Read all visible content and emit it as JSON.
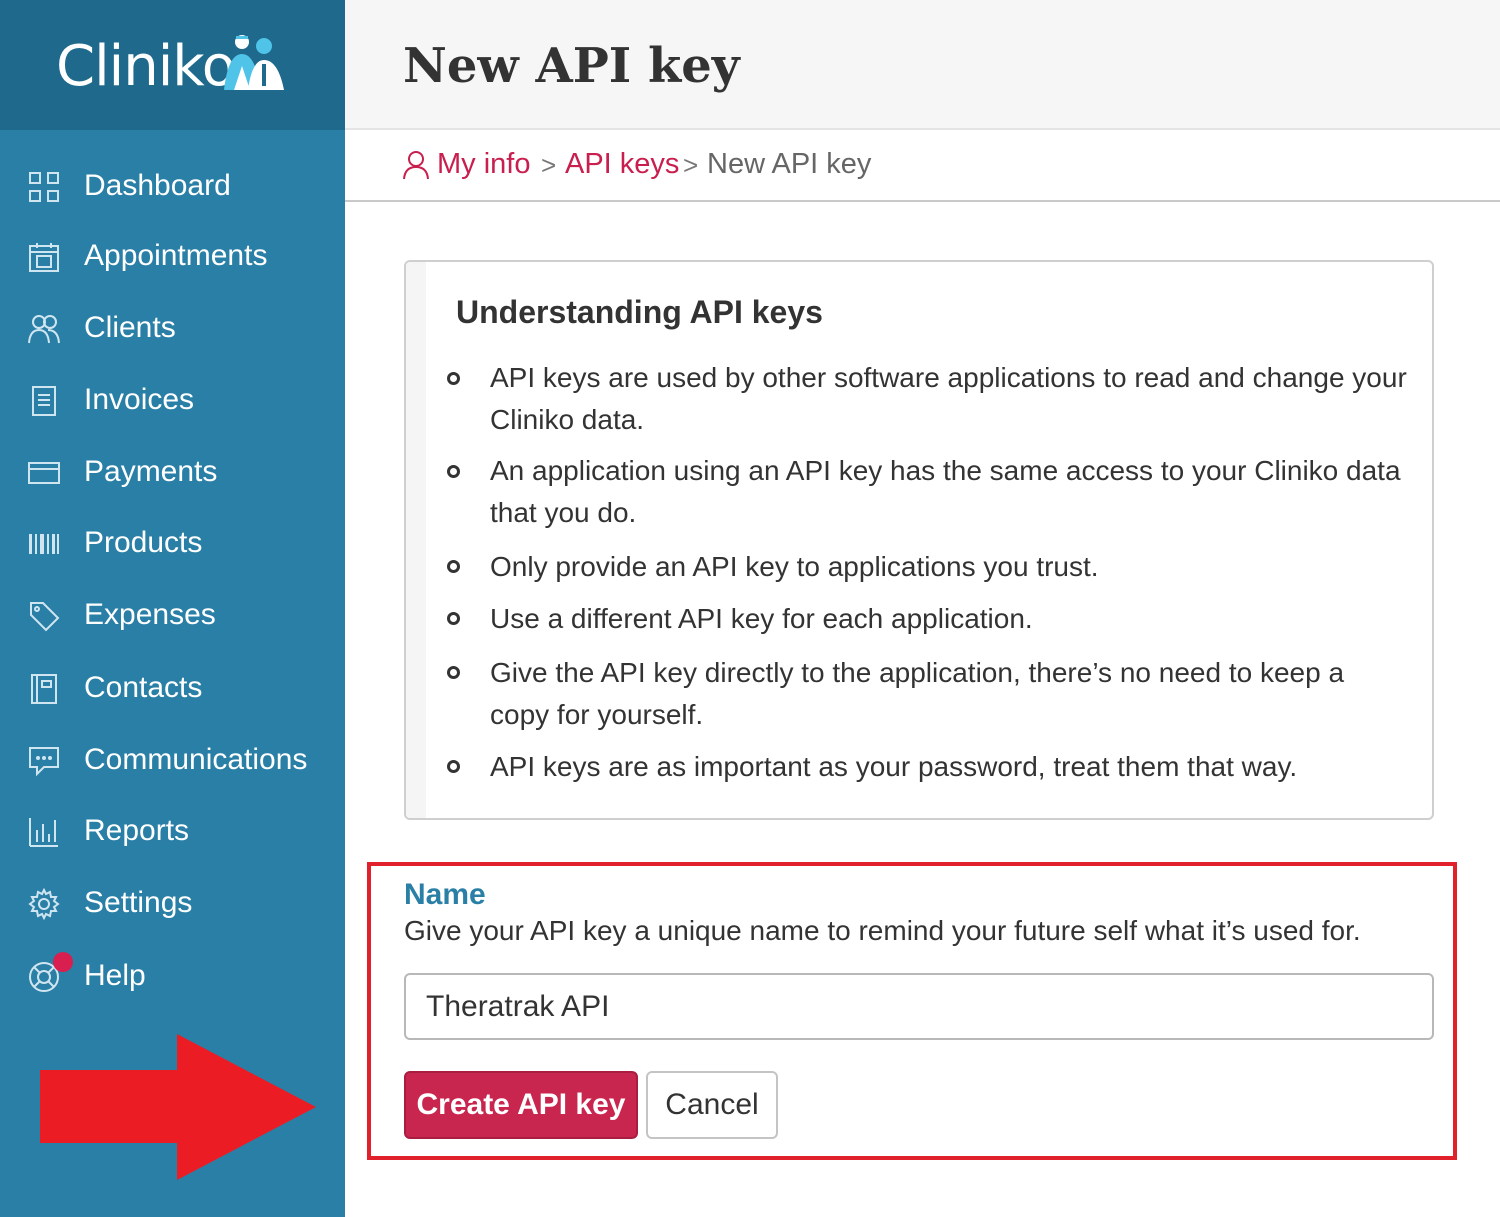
{
  "app": {
    "brand_name": "Cliniko",
    "brand_color": "#2a7fa6",
    "accent_color": "#c8264f",
    "logo_icon": "cliniko-people-icon"
  },
  "sidebar": {
    "items": [
      {
        "label": "Dashboard",
        "icon": "dashboard-grid-icon"
      },
      {
        "label": "Appointments",
        "icon": "calendar-icon"
      },
      {
        "label": "Clients",
        "icon": "people-icon"
      },
      {
        "label": "Invoices",
        "icon": "document-icon"
      },
      {
        "label": "Payments",
        "icon": "credit-card-icon"
      },
      {
        "label": "Products",
        "icon": "barcode-icon"
      },
      {
        "label": "Expenses",
        "icon": "tag-icon"
      },
      {
        "label": "Contacts",
        "icon": "address-book-icon"
      },
      {
        "label": "Communications",
        "icon": "chat-icon"
      },
      {
        "label": "Reports",
        "icon": "bar-chart-icon"
      },
      {
        "label": "Settings",
        "icon": "gear-icon"
      },
      {
        "label": "Help",
        "icon": "lifebuoy-icon"
      }
    ]
  },
  "header": {
    "title": "New API key"
  },
  "breadcrumb": {
    "items": [
      "My info",
      "API keys",
      "New API key"
    ],
    "separator": ">"
  },
  "info_box": {
    "title": "Understanding API keys",
    "bullets": [
      "API keys are used by other software applications to read and change your Cliniko data.",
      "An application using an API key has the same access to your Cliniko data that you do.",
      "Only provide an API key to applications you trust.",
      "Use a different API key for each application.",
      "Give the API key directly to the application, there’s no need to keep a copy for yourself.",
      "API keys are as important as your password, treat them that way."
    ]
  },
  "form": {
    "name_label": "Name",
    "name_help": "Give your API key a unique name to remind your future self what it’s used for.",
    "name_value": "Theratrak API",
    "submit_label": "Create API key",
    "cancel_label": "Cancel"
  },
  "annotation": {
    "highlight_color": "#e0202a",
    "arrow_color": "#ec1c24"
  }
}
